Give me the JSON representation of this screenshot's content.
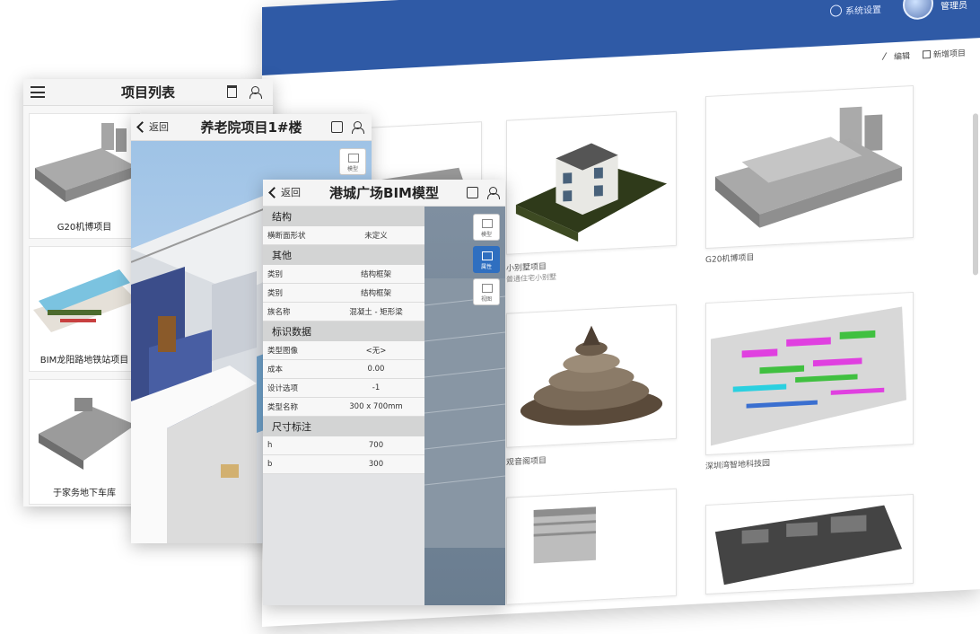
{
  "desktop": {
    "header": {
      "notice": "系统设置",
      "user": "管理员"
    },
    "toolbar": {
      "edit": "编辑",
      "add": "新增项目"
    },
    "cards": [
      {
        "label": "小别墅项目",
        "sub": "普通住宅小别墅"
      },
      {
        "label": "G20机博项目",
        "sub": ""
      },
      {
        "label": "观音阁项目",
        "sub": ""
      },
      {
        "label": "深圳湾智地科技园",
        "sub": ""
      }
    ]
  },
  "phone1": {
    "title": "项目列表",
    "items": [
      "G20机博项目",
      "BIM龙阳路地铁站项目",
      "于家务地下车库"
    ]
  },
  "phone2": {
    "back": "返回",
    "title": "养老院项目1#楼",
    "side": [
      "模型"
    ]
  },
  "phone3": {
    "back": "返回",
    "title": "港城广场BIM模型",
    "side": [
      "模型",
      "属性",
      "视图"
    ],
    "groups": [
      {
        "name": "结构",
        "rows": [
          {
            "k": "横断面形状",
            "v": "未定义"
          }
        ]
      },
      {
        "name": "其他",
        "rows": [
          {
            "k": "类别",
            "v": "结构框架"
          },
          {
            "k": "类别",
            "v": "结构框架"
          },
          {
            "k": "族名称",
            "v": "混凝土 - 矩形梁"
          }
        ]
      },
      {
        "name": "标识数据",
        "rows": [
          {
            "k": "类型图像",
            "v": "<无>"
          },
          {
            "k": "成本",
            "v": "0.00"
          },
          {
            "k": "设计选项",
            "v": "-1"
          },
          {
            "k": "类型名称",
            "v": "300 x 700mm"
          }
        ]
      },
      {
        "name": "尺寸标注",
        "rows": [
          {
            "k": "h",
            "v": "700"
          },
          {
            "k": "b",
            "v": "300"
          }
        ]
      }
    ]
  }
}
